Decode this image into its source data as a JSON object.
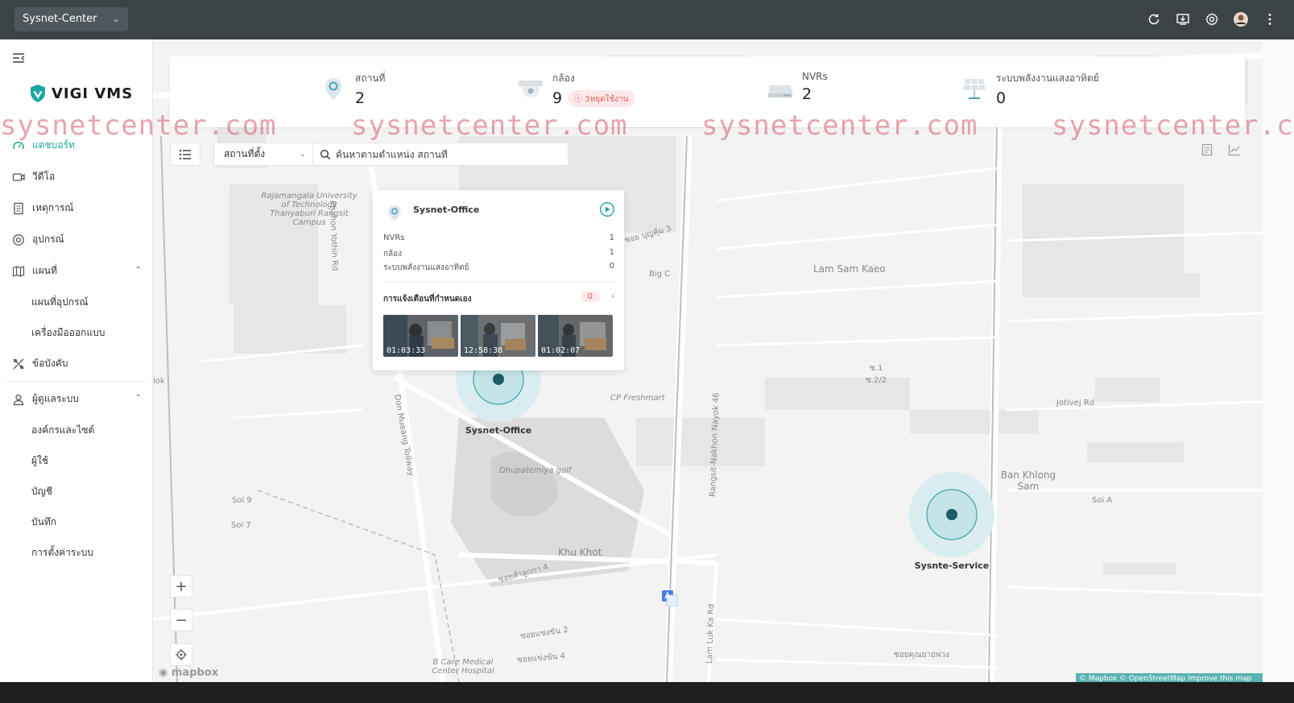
{
  "topbar": {
    "site_name": "Sysnet-Center",
    "icons": [
      "refresh-icon",
      "download-icon",
      "settings-icon",
      "avatar",
      "more-icon"
    ]
  },
  "sidebar": {
    "logo_text": "VIGI VMS",
    "items": [
      {
        "label": "แดชบอร์ท",
        "icon": "dashboard-icon",
        "active": true
      },
      {
        "label": "วีดีโอ",
        "icon": "video-icon"
      },
      {
        "label": "เหตุการณ์",
        "icon": "event-icon"
      },
      {
        "label": "อุปกรณ์",
        "icon": "device-icon"
      },
      {
        "label": "แผนที่",
        "icon": "map-icon",
        "expanded": true
      },
      {
        "label": "ข้อบังคับ",
        "icon": "rules-icon"
      },
      {
        "label": "ผู้ดูแลระบบ",
        "icon": "admin-icon",
        "expanded": true
      }
    ],
    "map_sub": [
      "แผนที่อุปกรณ์",
      "เครื่องมือออกแบบ"
    ],
    "admin_sub": [
      "องค์กรและไซต์",
      "ผู้ใช้",
      "บัญชี",
      "บันทึก",
      "การตั้งค่าระบบ"
    ]
  },
  "stats": [
    {
      "label": "สถานที่",
      "value": "2",
      "icon": "location-pin-icon"
    },
    {
      "label": "กล้อง",
      "value": "9",
      "icon": "camera-icon",
      "badge": "3หยุดใช้งาน"
    },
    {
      "label": "NVRs",
      "value": "2",
      "icon": "nvr-icon"
    },
    {
      "label": "ระบบพลังงานแสงอาทิตย์",
      "value": "0",
      "icon": "solar-panel-icon"
    }
  ],
  "watermark": "sysnetcenter.com",
  "search": {
    "location_select": "สถานที่ตั้ง",
    "placeholder": "ค้นหาตามตำแหน่ง สถานที่"
  },
  "popup": {
    "title": "Sysnet-Office",
    "rows": [
      {
        "label": "NVRs",
        "value": "1"
      },
      {
        "label": "กล้อง",
        "value": "1"
      },
      {
        "label": "ระบบพลังงานแสงอาทิตย์",
        "value": "0"
      }
    ],
    "alert_label": "การแจ้งเตือนที่กำหนดเอง",
    "alert_count": "0",
    "thumbnails": [
      "01:03:33",
      "12:58:38",
      "01:02:07"
    ]
  },
  "markers": [
    {
      "name": "Sysnet-Office"
    },
    {
      "name": "Sysnte-Service"
    }
  ],
  "map_labels": {
    "university": "Rajamangala University of Technology Thanyaburi Rangsit Campus",
    "phahon": "Phahon Yothin Rd",
    "big_c": "Big C",
    "lam_sam_kaeo": "Lam Sam Kaeo",
    "cp_freshmart": "CP Freshmart",
    "don_mueang": "Don Mueang Tollway",
    "golf": "Dhupatemiya golf",
    "rangsit_nayok": "Rangsit-Nakhon Nayok 46",
    "khu_khot": "Khu Khot",
    "ban_khlong_sam": "Ban Khlong Sam",
    "soi_a": "Soi A",
    "jotivej": "Jotivej Rd",
    "soi9": "Soi 9",
    "soi7": "Soi 7",
    "lam_luk_ka": "Lam Luk Ka Rd",
    "b_care": "B Care Medical Center Hospital",
    "lok": "lok",
    "soi_boonkum": "ซอย บุญคุ้ม 3",
    "s1": "ซ.1",
    "s2": "ซ.2/2",
    "soi_lamlukka4": "ซอยลำลูกกา 4",
    "soi_khaengkhan2": "ซอยแข่งขัน 2",
    "soi_khaengkhan4": "ซอยแข่งขัน 4",
    "soi_khunyai": "ซอยคุณยายพ่วง"
  },
  "attribution": "© Mapbox © OpenStreetMap Improve this map",
  "mapbox_logo": "mapbox",
  "zoom": {
    "in": "+",
    "out": "−"
  }
}
